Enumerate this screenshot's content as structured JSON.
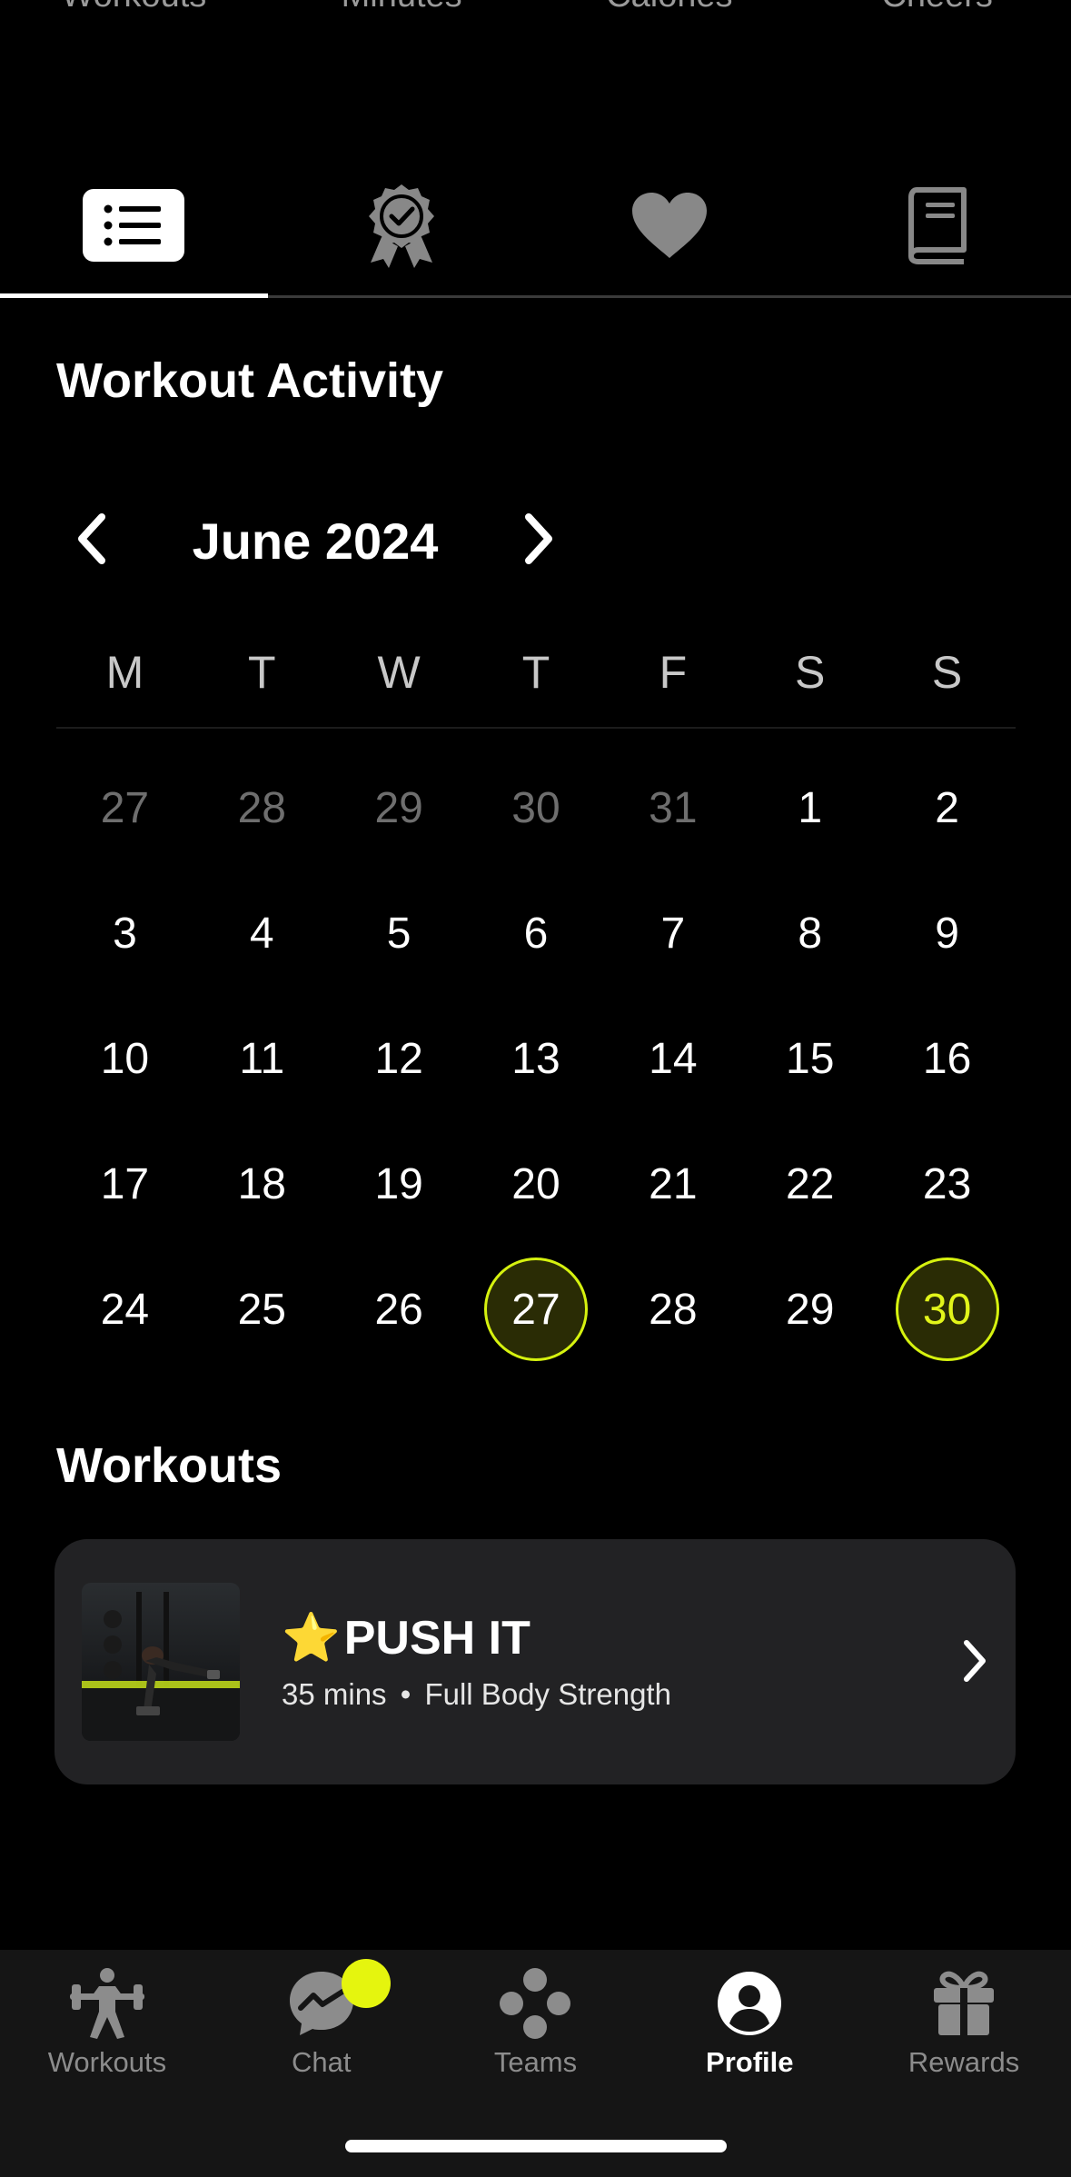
{
  "stats_labels": [
    "Workouts",
    "Minutes",
    "Calories",
    "Cheers"
  ],
  "profile_tabs": [
    {
      "icon": "list-icon",
      "active": true
    },
    {
      "icon": "badge-icon",
      "active": false
    },
    {
      "icon": "heart-icon",
      "active": false
    },
    {
      "icon": "book-icon",
      "active": false
    }
  ],
  "activity": {
    "title": "Workout Activity"
  },
  "calendar": {
    "month_label": "June 2024",
    "weekdays": [
      "M",
      "T",
      "W",
      "T",
      "F",
      "S",
      "S"
    ],
    "weeks": [
      [
        "27",
        "28",
        "29",
        "30",
        "31",
        "1",
        "2"
      ],
      [
        "3",
        "4",
        "5",
        "6",
        "7",
        "8",
        "9"
      ],
      [
        "10",
        "11",
        "12",
        "13",
        "14",
        "15",
        "16"
      ],
      [
        "17",
        "18",
        "19",
        "20",
        "21",
        "22",
        "23"
      ],
      [
        "24",
        "25",
        "26",
        "27",
        "28",
        "29",
        "30"
      ]
    ],
    "muted_days_first_week": 5,
    "highlighted": [
      "27"
    ],
    "today": "30",
    "accent_color": "#d6f20f"
  },
  "workouts": {
    "title": "Workouts",
    "items": [
      {
        "star": "⭐",
        "name": "PUSH IT",
        "duration": "35 mins",
        "separator": "•",
        "category": "Full Body Strength"
      }
    ]
  },
  "tabbar": {
    "items": [
      {
        "label": "Workouts",
        "icon": "workouts-icon"
      },
      {
        "label": "Chat",
        "icon": "chat-icon"
      },
      {
        "label": "Teams",
        "icon": "teams-icon"
      },
      {
        "label": "Profile",
        "icon": "profile-icon"
      },
      {
        "label": "Rewards",
        "icon": "rewards-icon"
      }
    ],
    "active": "Profile",
    "notification_color": "#e5f50e"
  }
}
